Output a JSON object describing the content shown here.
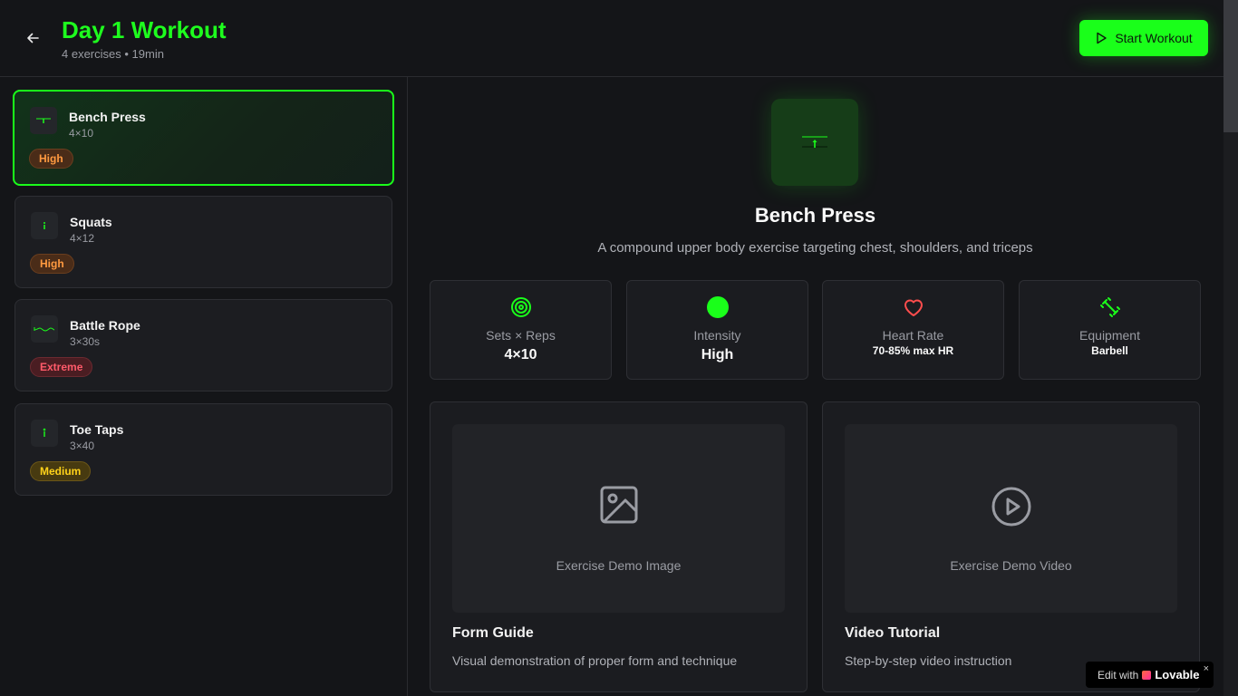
{
  "header": {
    "title": "Day 1 Workout",
    "subtitle": "4 exercises • 19min",
    "start_label": "Start Workout"
  },
  "exercises": [
    {
      "name": "Bench Press",
      "reps": "4×10",
      "intensity": "High",
      "active": true
    },
    {
      "name": "Squats",
      "reps": "4×12",
      "intensity": "High",
      "active": false
    },
    {
      "name": "Battle Rope",
      "reps": "3×30s",
      "intensity": "Extreme",
      "active": false
    },
    {
      "name": "Toe Taps",
      "reps": "3×40",
      "intensity": "Medium",
      "active": false
    }
  ],
  "detail": {
    "title": "Bench Press",
    "description": "A compound upper body exercise targeting chest, shoulders, and triceps",
    "stats": [
      {
        "label": "Sets × Reps",
        "value": "4×10",
        "icon": "target-icon"
      },
      {
        "label": "Intensity",
        "value": "High",
        "icon": "intensity-dot-icon"
      },
      {
        "label": "Heart Rate",
        "value": "70-85% max HR",
        "icon": "heart-icon"
      },
      {
        "label": "Equipment",
        "value": "Barbell",
        "icon": "dumbbell-icon"
      }
    ],
    "media": [
      {
        "placeholder": "Exercise Demo Image",
        "title": "Form Guide",
        "description": "Visual demonstration of proper form and technique",
        "icon": "image-icon"
      },
      {
        "placeholder": "Exercise Demo Video",
        "title": "Video Tutorial",
        "description": "Step-by-step video instruction",
        "icon": "play-circle-icon"
      }
    ]
  },
  "badge": {
    "prefix": "Edit with",
    "brand": "Lovable",
    "close": "×"
  },
  "colors": {
    "accent": "#1aff1a",
    "background": "#141518",
    "card": "#1c1d21",
    "high": "#ff9a40",
    "extreme": "#ff5a6a",
    "medium": "#ffd21a",
    "heart": "#ff4d4d"
  }
}
